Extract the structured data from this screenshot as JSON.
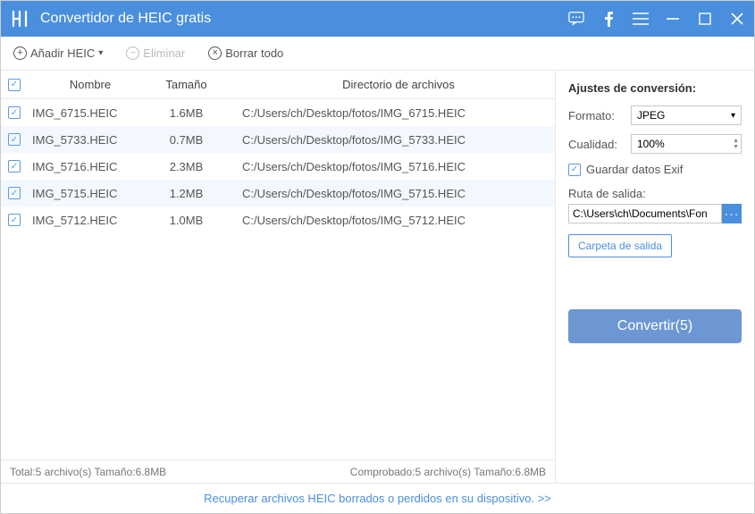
{
  "accent": "#4a8fdd",
  "titlebar": {
    "title": "Convertidor de HEIC gratis"
  },
  "toolbar": {
    "add_label": "Añadir HEIC",
    "remove_label": "Eliminar",
    "clear_label": "Borrar todo"
  },
  "columns": {
    "name": "Nombre",
    "size": "Tamaño",
    "dir": "Directorio de archivos"
  },
  "files": [
    {
      "checked": true,
      "name": "IMG_6715.HEIC",
      "size": "1.6MB",
      "dir": "C:/Users/ch/Desktop/fotos/IMG_6715.HEIC"
    },
    {
      "checked": true,
      "name": "IMG_5733.HEIC",
      "size": "0.7MB",
      "dir": "C:/Users/ch/Desktop/fotos/IMG_5733.HEIC"
    },
    {
      "checked": true,
      "name": "IMG_5716.HEIC",
      "size": "2.3MB",
      "dir": "C:/Users/ch/Desktop/fotos/IMG_5716.HEIC"
    },
    {
      "checked": true,
      "name": "IMG_5715.HEIC",
      "size": "1.2MB",
      "dir": "C:/Users/ch/Desktop/fotos/IMG_5715.HEIC"
    },
    {
      "checked": true,
      "name": "IMG_5712.HEIC",
      "size": "1.0MB",
      "dir": "C:/Users/ch/Desktop/fotos/IMG_5712.HEIC"
    }
  ],
  "status": {
    "total": "Total:5 archivo(s) Tamaño:6.8MB",
    "checked": "Comprobado:5 archivo(s) Tamaño:6.8MB"
  },
  "settings": {
    "title": "Ajustes de conversión:",
    "format_label": "Formato:",
    "format_value": "JPEG",
    "quality_label": "Cualidad:",
    "quality_value": "100%",
    "exif_label": "Guardar datos Exif",
    "output_label": "Ruta de salida:",
    "output_path": "C:\\Users\\ch\\Documents\\Fon",
    "folder_button": "Carpeta de salida",
    "convert_button": "Convertir(5)"
  },
  "footer": {
    "link": "Recuperar archivos HEIC borrados o perdidos en su dispositivo. >>"
  }
}
